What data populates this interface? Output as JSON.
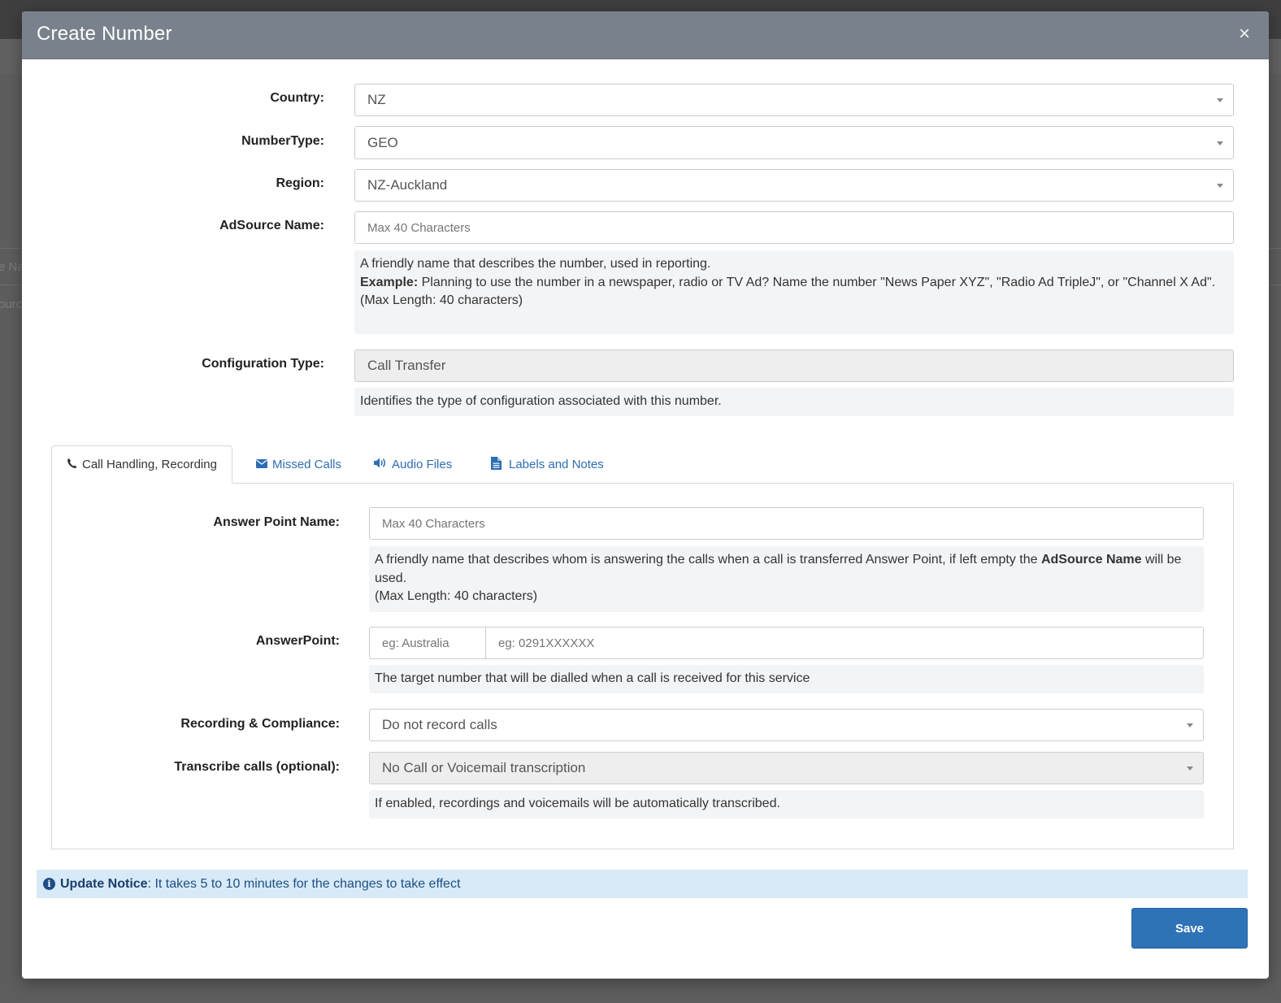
{
  "backdrop": {
    "fragment_1": "e Na",
    "fragment_2": "ourc"
  },
  "modal": {
    "title": "Create Number",
    "close_glyph": "×"
  },
  "form": {
    "country": {
      "label": "Country:",
      "value": "NZ"
    },
    "number_type": {
      "label": "NumberType:",
      "value": "GEO"
    },
    "region": {
      "label": "Region:",
      "value": "NZ-Auckland"
    },
    "adsource_name": {
      "label": "AdSource Name:",
      "placeholder": "Max 40 Characters",
      "help_line1": "A friendly name that describes the number, used in reporting.",
      "help_example_label": "Example:",
      "help_example_text": " Planning to use the number in a newspaper, radio or TV Ad? Name the number \"News Paper XYZ\", \"Radio Ad TripleJ\", or \"Channel X Ad\".",
      "help_line3": "(Max Length: 40 characters)"
    },
    "configuration_type": {
      "label": "Configuration Type:",
      "value": "Call Transfer",
      "help": "Identifies the type of configuration associated with this number."
    }
  },
  "tabs": [
    {
      "label": "Call Handling, Recording",
      "icon": "phone-icon",
      "active": true
    },
    {
      "label": "Missed Calls",
      "icon": "envelope-icon",
      "active": false
    },
    {
      "label": "Audio Files",
      "icon": "volume-icon",
      "active": false
    },
    {
      "label": "Labels and Notes",
      "icon": "file-text-icon",
      "active": false
    }
  ],
  "call_handling": {
    "answer_point_name": {
      "label": "Answer Point Name:",
      "placeholder": "Max 40 Characters",
      "help_text_1": "A friendly name that describes whom is answering the calls when a call is transferred Answer Point, if left empty the ",
      "help_bold": "AdSource Name",
      "help_text_2": " will be used.",
      "help_line2": "(Max Length: 40 characters)"
    },
    "answer_point": {
      "label": "AnswerPoint:",
      "country_placeholder": "eg: Australia",
      "number_placeholder": "eg: 0291XXXXXX",
      "help": "The target number that will be dialled when a call is received for this service"
    },
    "recording": {
      "label": "Recording & Compliance:",
      "value": "Do not record calls"
    },
    "transcribe": {
      "label": "Transcribe calls (optional):",
      "value": "No Call or Voicemail transcription",
      "help": "If enabled, recordings and voicemails will be automatically transcribed."
    }
  },
  "notice": {
    "title": "Update Notice",
    "text": ": It takes 5 to 10 minutes for the changes to take effect"
  },
  "footer": {
    "save_label": "Save"
  },
  "colors": {
    "header_bg": "#79828c",
    "primary": "#2e72b8",
    "link": "#2d6db4",
    "notice_bg": "#d8eaf7"
  }
}
